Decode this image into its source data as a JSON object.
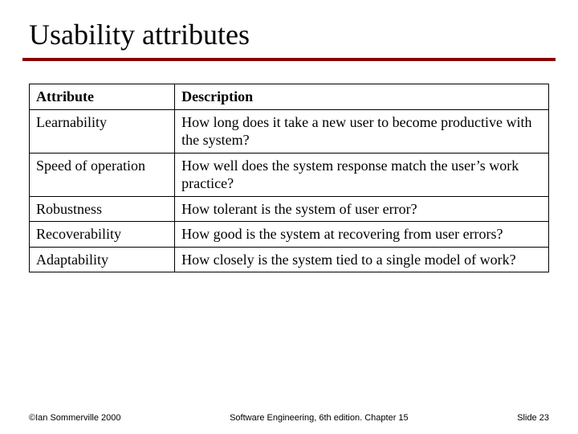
{
  "title": "Usability attributes",
  "table": {
    "headers": {
      "attribute": "Attribute",
      "description": "Description"
    },
    "rows": [
      {
        "attribute": "Learnability",
        "description": "How long does it take a new user to become productive with the system?"
      },
      {
        "attribute": "Speed of operation",
        "description": "How well does the system response match the user’s work practice?"
      },
      {
        "attribute": "Robustness",
        "description": "How tolerant is the system of user error?"
      },
      {
        "attribute": "Recoverability",
        "description": "How good is the system at recovering from user errors?"
      },
      {
        "attribute": "Adaptability",
        "description": "How closely is the system tied to a single model of work?"
      }
    ]
  },
  "footer": {
    "left": "©Ian Sommerville 2000",
    "center": "Software Engineering, 6th edition. Chapter 15",
    "right": "Slide 23"
  }
}
